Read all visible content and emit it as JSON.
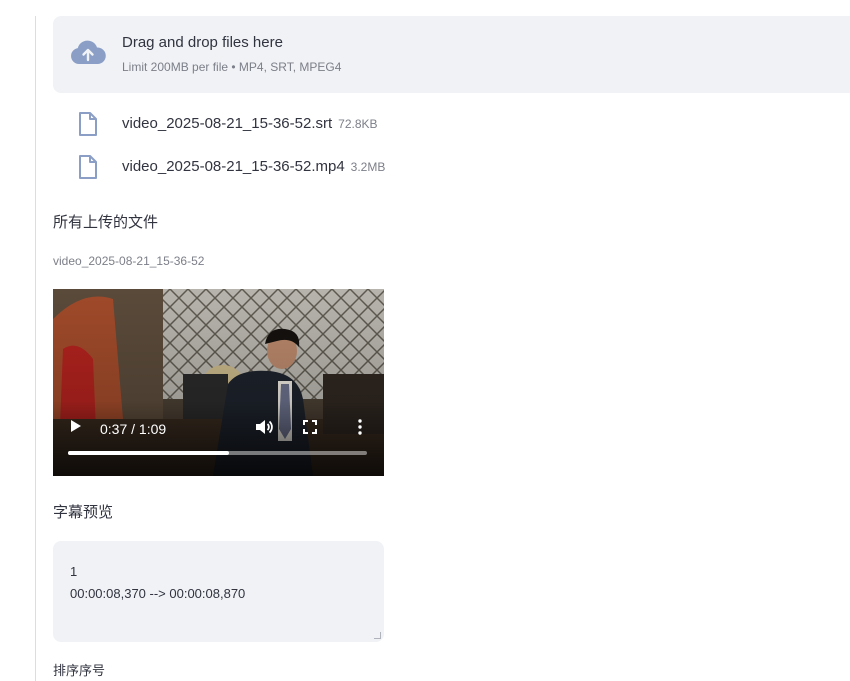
{
  "uploader": {
    "title": "Drag and drop files here",
    "hint": "Limit 200MB per file • MP4, SRT, MPEG4",
    "icon": "cloud-upload-icon"
  },
  "files": [
    {
      "name": "video_2025-08-21_15-36-52.srt",
      "size": "72.8KB",
      "icon": "file-icon"
    },
    {
      "name": "video_2025-08-21_15-36-52.mp4",
      "size": "3.2MB",
      "icon": "file-icon"
    }
  ],
  "uploaded_section": {
    "heading": "所有上传的文件",
    "item_caption": "video_2025-08-21_15-36-52"
  },
  "video_player": {
    "time": "0:37 / 1:09",
    "progress": 0.54,
    "icons": [
      "play-icon",
      "volume-icon",
      "fullscreen-icon",
      "more-options-icon"
    ]
  },
  "subtitle_preview": {
    "heading": "字幕预览",
    "line1": "1",
    "line2": "00:00:08,370 --> 00:00:08,870"
  },
  "sort_label": "排序序号",
  "colors": {
    "accent_icon": "#8a9ec6",
    "panel_bg": "#f0f2f6",
    "text": "#31333f",
    "muted": "#7c7f88"
  }
}
